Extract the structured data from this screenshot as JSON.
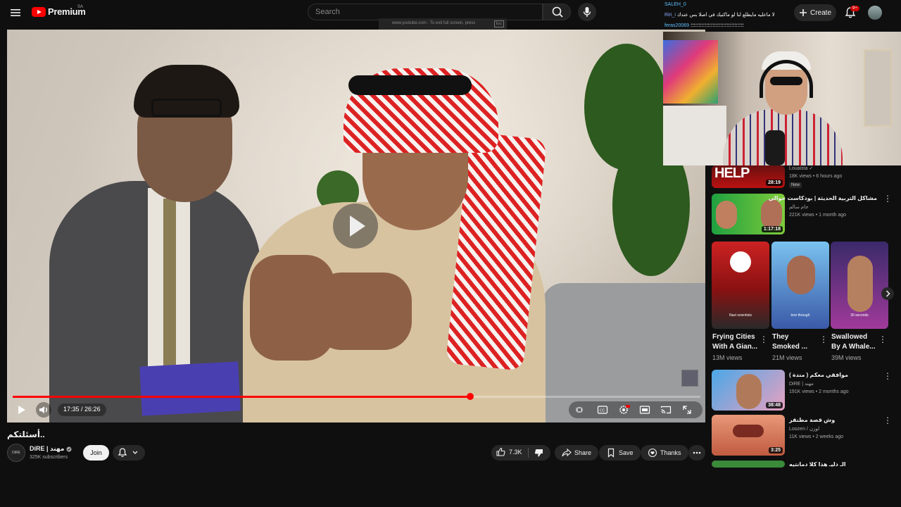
{
  "header": {
    "logo_text": "Premium",
    "logo_region": "SA",
    "search_placeholder": "Search",
    "fullscreen_hint": "www.youtube.com - To exit full screen, press",
    "fullscreen_key": "Esc",
    "create_label": "Create",
    "notification_count": "9+"
  },
  "chat": {
    "messages": [
      {
        "user": "SALEH_0",
        "text": ""
      },
      {
        "user": "Riri_i",
        "text": "لا ماعليه مايطلع لنا لو ماكنيك في اصلا بس عندك"
      },
      {
        "user": "feras20069",
        "text": "؛؛؛؛؛؛؛؛؛؛؛؛؛؛؛؛؛؛؛؛؛؛؛؛؛؛؛؛؛؛؛؛؛؛"
      }
    ]
  },
  "player": {
    "time_current": "17:35",
    "time_separator": " / ",
    "time_total": "26:26",
    "progress": 0.665,
    "watermark": "DiRE"
  },
  "video": {
    "title": "..أسئلتكم",
    "channel_name": "DiRE | مهند",
    "channel_subs": "325K subscribers",
    "channel_avatar_text": "DiRE",
    "join_label": "Join",
    "like_count": "7.3K",
    "share_label": "Share",
    "save_label": "Save",
    "thanks_label": "Thanks"
  },
  "sidebar": {
    "top_item": {
      "thumb_text": "HELP",
      "channel": "Louaista",
      "meta": "18K views • 6 hours ago",
      "badge": "New",
      "duration": "28:19"
    },
    "items": [
      {
        "title": "مشاكل التربية الحديثة | بودكاست حوالي",
        "channel": "جام سالم",
        "meta": "221K views • 1 month ago",
        "duration": "1:17:18"
      },
      {
        "title": "موافقي معكم ( مندة )",
        "channel": "DiRE | مهند",
        "meta": "191K views • 2 months ago",
        "duration": "38:48"
      },
      {
        "title": "وش قصة مطنقر",
        "channel": "Loozen / لوزن",
        "meta": "11K views • 2 weeks ago",
        "duration": "3:25"
      },
      {
        "title": "الـ دليـ هذا كلا دمانتيه",
        "channel": "",
        "meta": "",
        "duration": ""
      }
    ],
    "shorts": [
      {
        "title_line1": "Frying Cities",
        "title_line2": "With A Gian...",
        "views": "13M views",
        "caption": "Nazi scientists"
      },
      {
        "title_line1": "They",
        "title_line2": "Smoked ...",
        "views": "21M views",
        "caption": "tore through"
      },
      {
        "title_line1": "Swallowed",
        "title_line2": "By A Whale...",
        "views": "39M views",
        "caption": "30 seconds"
      }
    ]
  },
  "colors": {
    "accent": "#ff0000",
    "background": "#0f0f0f",
    "pill": "#272727"
  }
}
